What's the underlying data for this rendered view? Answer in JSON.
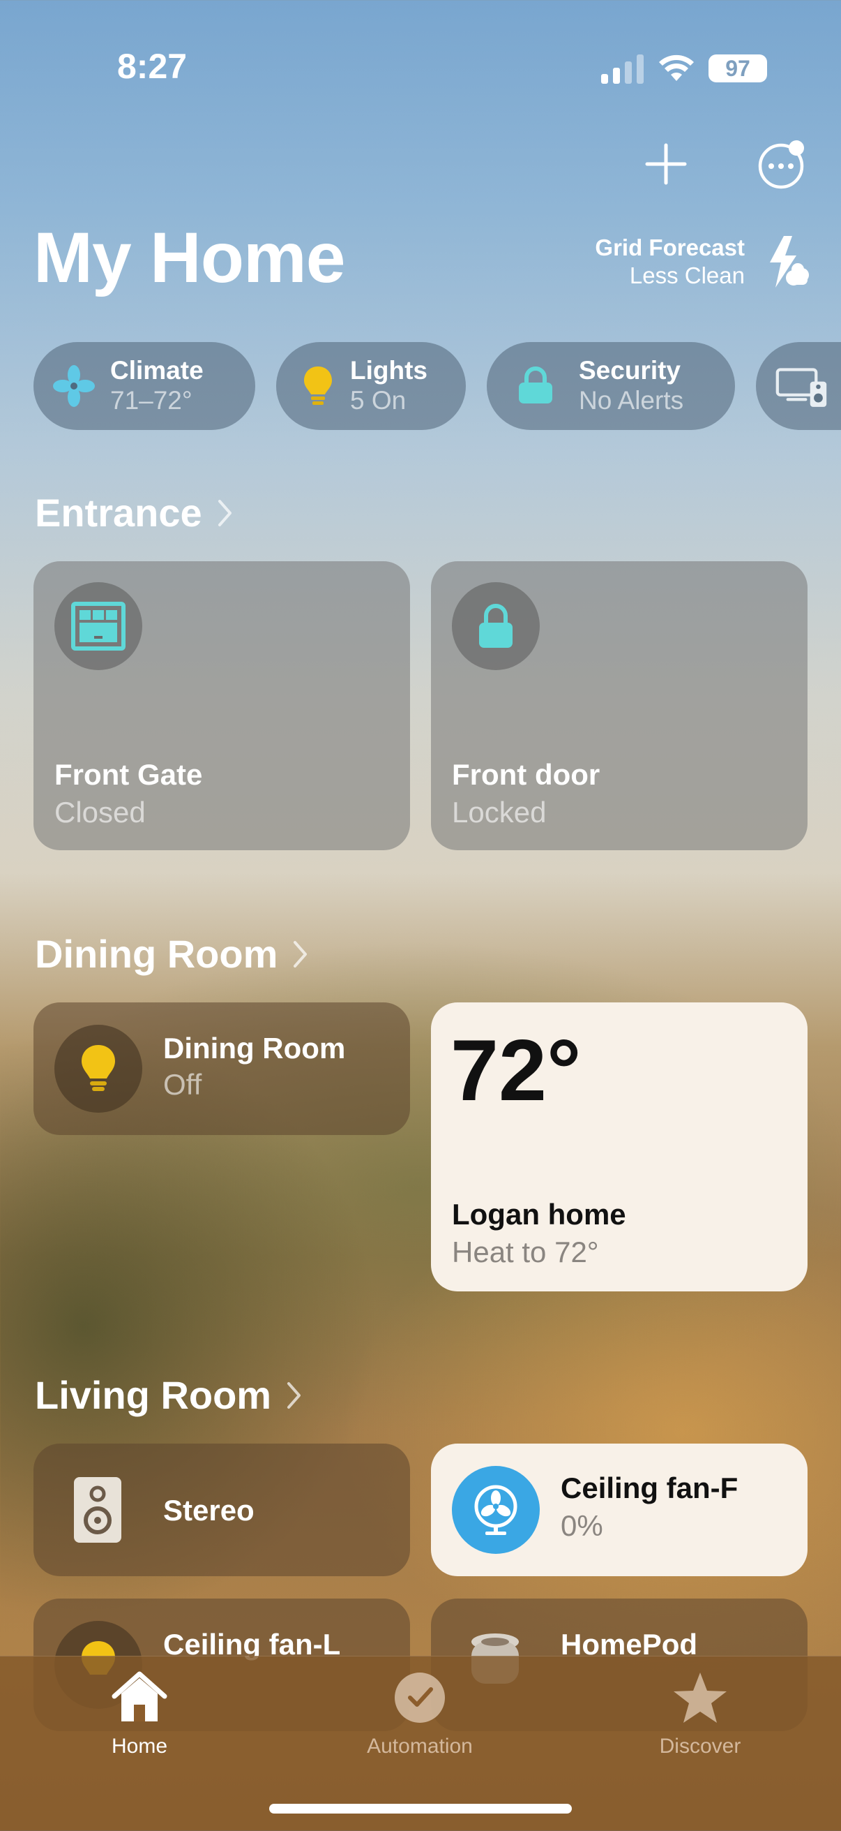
{
  "status_bar": {
    "time": "8:27",
    "battery": "97"
  },
  "header": {
    "title": "My Home",
    "grid_forecast": {
      "title": "Grid Forecast",
      "subtitle": "Less Clean"
    }
  },
  "categories": [
    {
      "label": "Climate",
      "value": "71–72°",
      "icon": "fan-icon"
    },
    {
      "label": "Lights",
      "value": "5 On",
      "icon": "lightbulb-icon"
    },
    {
      "label": "Security",
      "value": "No Alerts",
      "icon": "lock-icon"
    },
    {
      "label": "",
      "value": "",
      "icon": "speakers-tv-icon"
    }
  ],
  "sections": {
    "entrance": {
      "title": "Entrance",
      "tiles": [
        {
          "name": "Front Gate",
          "state": "Closed",
          "icon": "garage-door-icon"
        },
        {
          "name": "Front door",
          "state": "Locked",
          "icon": "lock-icon"
        }
      ]
    },
    "dining_room": {
      "title": "Dining Room",
      "light": {
        "name": "Dining Room",
        "state": "Off",
        "icon": "lightbulb-icon"
      },
      "thermostat": {
        "temperature": "72°",
        "name": "Logan home",
        "state": "Heat to 72°"
      }
    },
    "living_room": {
      "title": "Living Room",
      "tiles": [
        {
          "name": "Stereo",
          "icon": "speaker-icon"
        },
        {
          "name": "Ceiling fan-F",
          "state": "0%",
          "icon": "fan-icon"
        },
        {
          "name": "Ceiling fan-L",
          "icon": "lightbulb-icon"
        },
        {
          "name": "HomePod",
          "icon": "homepod-icon"
        }
      ]
    }
  },
  "tabbar": {
    "tabs": [
      {
        "label": "Home",
        "active": true
      },
      {
        "label": "Automation",
        "active": false
      },
      {
        "label": "Discover",
        "active": false
      }
    ]
  },
  "colors": {
    "accent_cyan": "#5fd8d8",
    "bulb_yellow": "#f2c315",
    "fan_blue": "#3aa7e4"
  }
}
